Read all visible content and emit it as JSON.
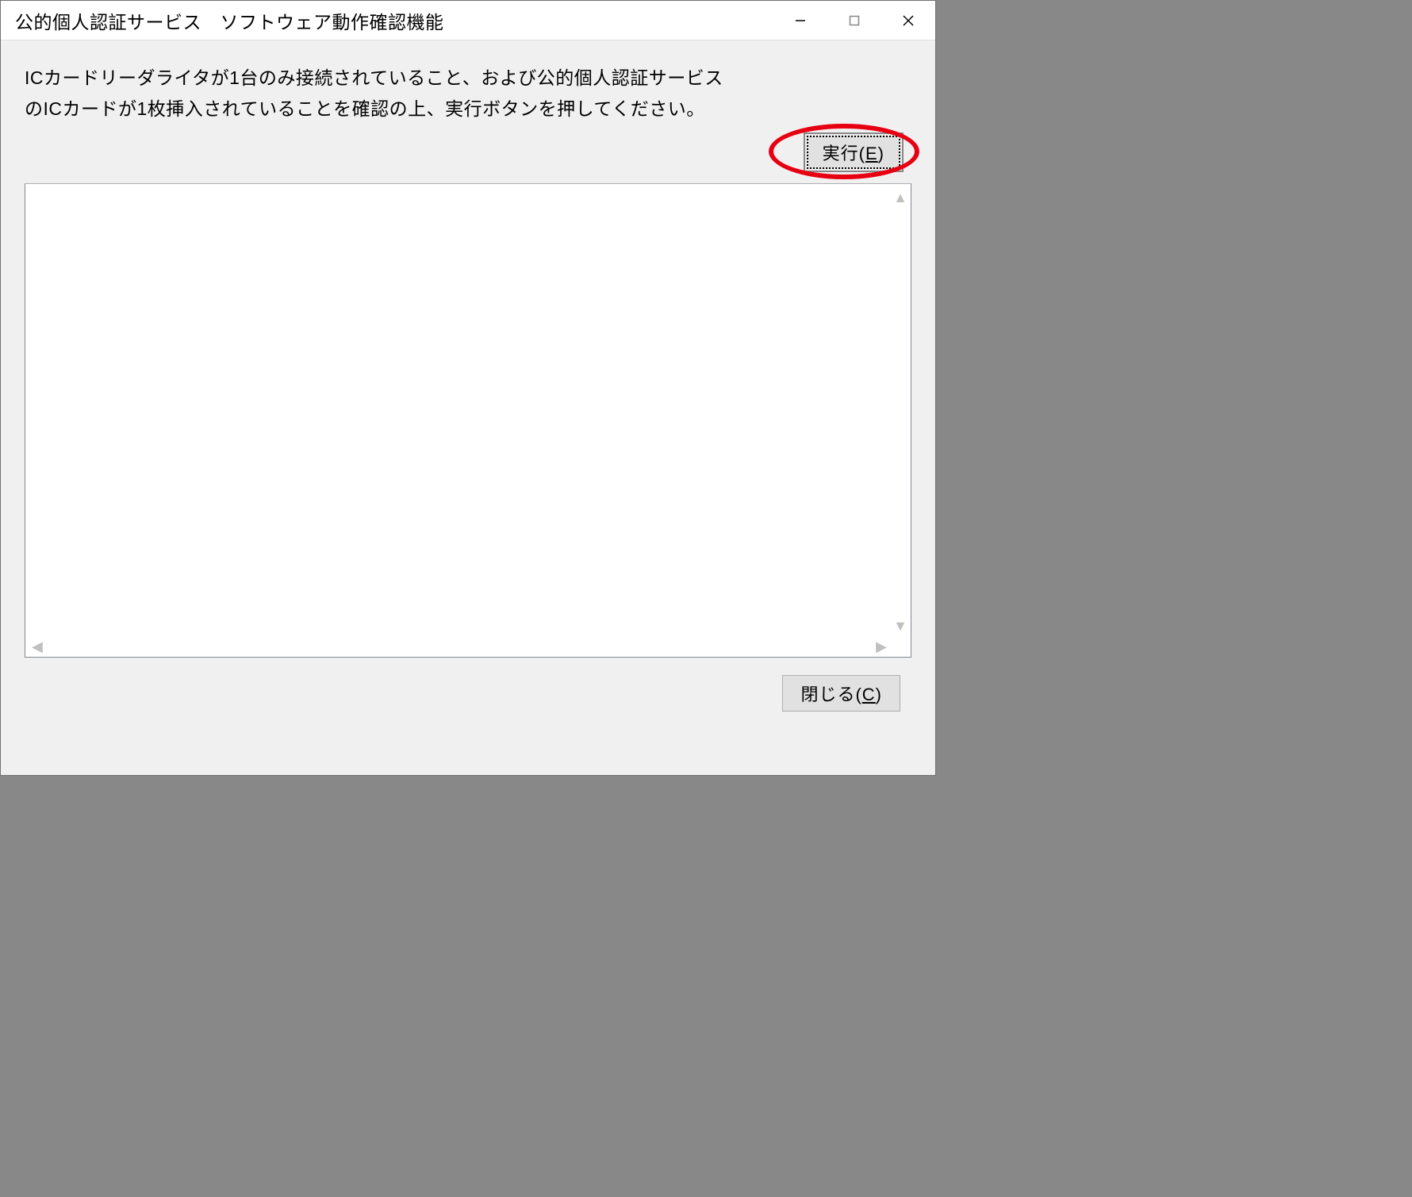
{
  "window": {
    "title": "公的個人認証サービス　ソフトウェア動作確認機能"
  },
  "instruction": {
    "line1": "ICカードリーダライタが1台のみ接続されていること、および公的個人認証サービス",
    "line2": "のICカードが1枚挿入されていることを確認の上、実行ボタンを押してください。"
  },
  "buttons": {
    "execute_prefix": "実行(",
    "execute_key": "E",
    "execute_suffix": ")",
    "close_prefix": "閉じる(",
    "close_key": "C",
    "close_suffix": ")"
  },
  "output": {
    "content": ""
  }
}
